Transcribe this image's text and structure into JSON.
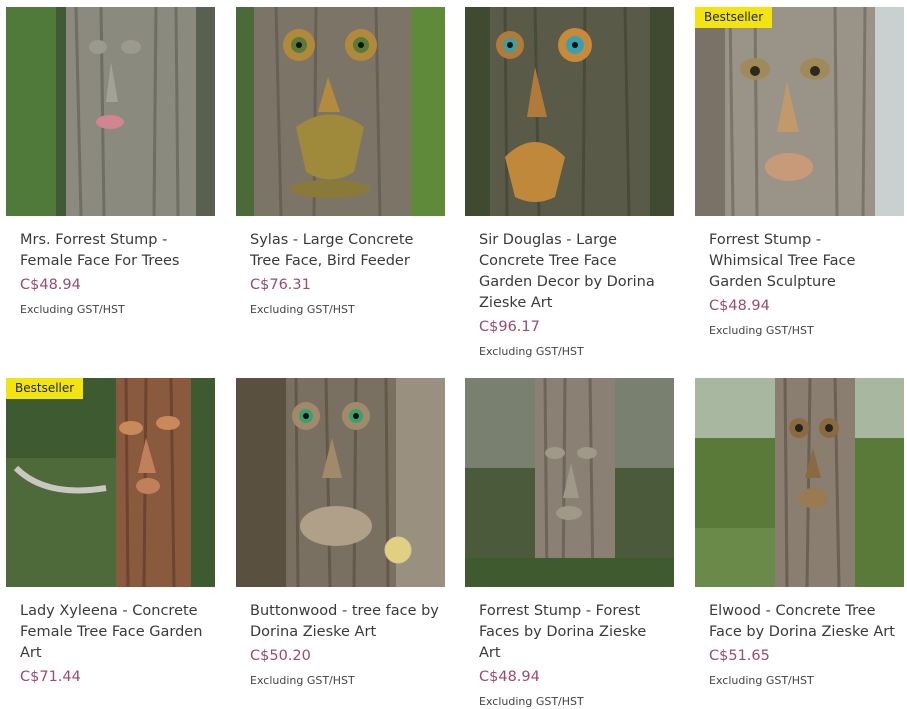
{
  "products": [
    {
      "title": "Mrs. Forrest Stump - Female Face For Trees",
      "price": "C$48.94",
      "tax_note": "Excluding GST/HST",
      "image": "tree-face-image",
      "badge": ""
    },
    {
      "title": "Sylas - Large Concrete Tree Face, Bird Feeder",
      "price": "C$76.31",
      "tax_note": "Excluding GST/HST",
      "image": "tree-face-image",
      "badge": ""
    },
    {
      "title": "Sir Douglas - Large Concrete Tree Face Garden Decor by Dorina Zieske Art",
      "price": "C$96.17",
      "tax_note": "Excluding GST/HST",
      "image": "tree-face-image",
      "badge": ""
    },
    {
      "title": "Forrest Stump - Whimsical Tree Face Garden Sculpture",
      "price": "C$48.94",
      "tax_note": "Excluding GST/HST",
      "image": "tree-face-image",
      "badge": "Bestseller"
    },
    {
      "title": "Lady Xyleena - Concrete Female Tree Face Garden Art",
      "price": "C$71.44",
      "tax_note": "",
      "image": "tree-face-image",
      "badge": "Bestseller"
    },
    {
      "title": "Buttonwood - tree face by Dorina Zieske Art",
      "price": "C$50.20",
      "tax_note": "Excluding GST/HST",
      "image": "tree-face-image",
      "badge": ""
    },
    {
      "title": "Forrest Stump - Forest Faces by Dorina Zieske Art",
      "price": "C$48.94",
      "tax_note": "Excluding GST/HST",
      "image": "tree-face-image",
      "badge": ""
    },
    {
      "title": "Elwood - Concrete Tree Face by Dorina Zieske Art",
      "price": "C$51.65",
      "tax_note": "Excluding GST/HST",
      "image": "tree-face-image",
      "badge": ""
    }
  ],
  "colors": {
    "price": "#9a4a72",
    "badge_bg": "#f1e40f",
    "text": "#3a3a3a"
  }
}
